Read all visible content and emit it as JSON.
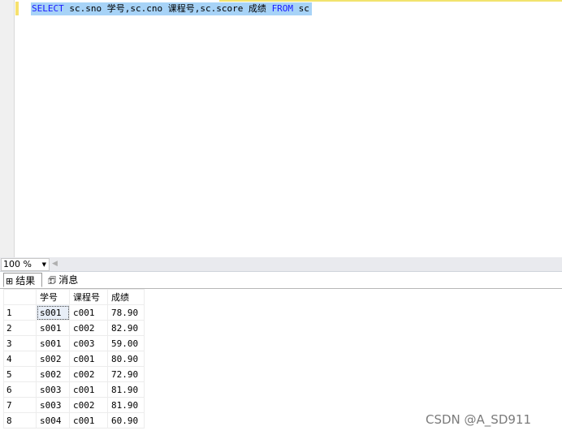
{
  "editor": {
    "sql_parts": {
      "select_kw": "SELECT",
      "body": " sc.sno 学号,sc.cno 课程号,sc.score 成绩 ",
      "from_kw": "FROM",
      "table": " sc"
    }
  },
  "zoom": {
    "value": "100 %",
    "caret": "▼",
    "scroll_left": "◀"
  },
  "tabs": {
    "results_icon": "⊞",
    "results_label": "结果",
    "messages_icon": "🗊",
    "messages_label": "消息"
  },
  "grid": {
    "headers": [
      "学号",
      "课程号",
      "成绩"
    ],
    "rows": [
      {
        "n": "1",
        "sno": "s001",
        "cno": "c001",
        "score": "78.90"
      },
      {
        "n": "2",
        "sno": "s001",
        "cno": "c002",
        "score": "82.90"
      },
      {
        "n": "3",
        "sno": "s001",
        "cno": "c003",
        "score": "59.00"
      },
      {
        "n": "4",
        "sno": "s002",
        "cno": "c001",
        "score": "80.90"
      },
      {
        "n": "5",
        "sno": "s002",
        "cno": "c002",
        "score": "72.90"
      },
      {
        "n": "6",
        "sno": "s003",
        "cno": "c001",
        "score": "81.90"
      },
      {
        "n": "7",
        "sno": "s003",
        "cno": "c002",
        "score": "81.90"
      },
      {
        "n": "8",
        "sno": "s004",
        "cno": "c001",
        "score": "60.90"
      }
    ]
  },
  "watermark": "CSDN @A_SD911"
}
